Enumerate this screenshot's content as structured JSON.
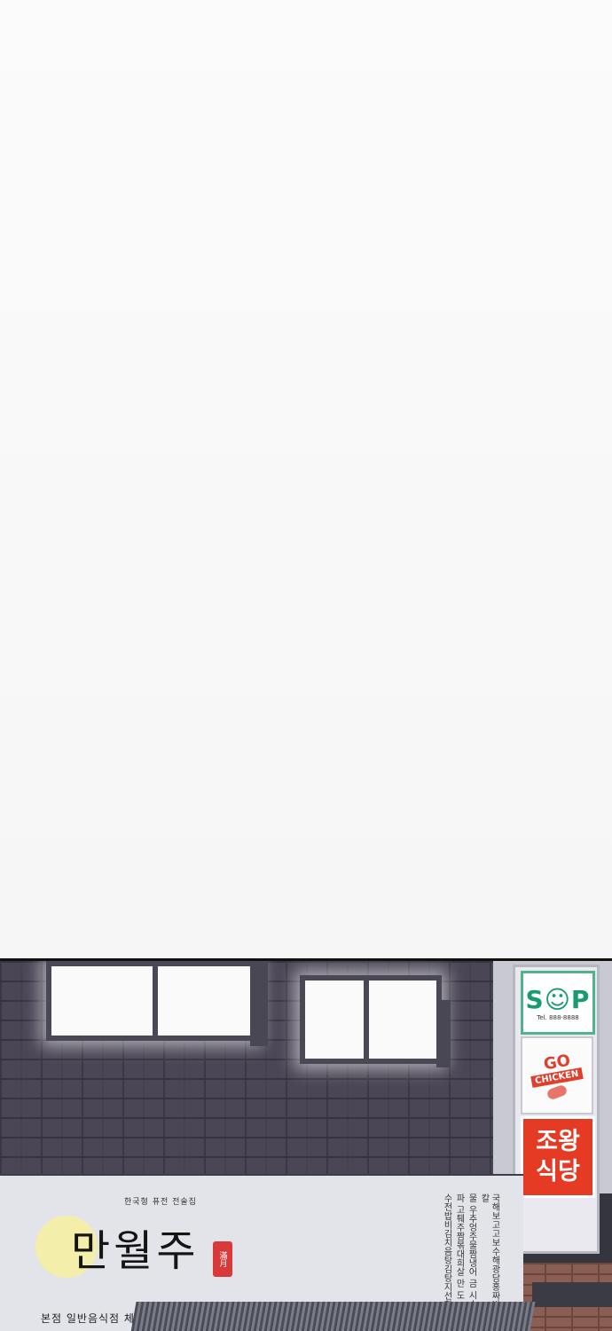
{
  "panel": {
    "storefront": {
      "subtitle": "한국형 퓨전 전술집",
      "title": "만월주",
      "seal_text": "滿月",
      "bottom_line": "본점 일반음식점 체인점문의",
      "menu_columns": [
        "국해보고고보수해광담홍짜반김칼",
        "물 우추엉주물짬냉어 금 시소",
        "파 고퉤주짬볶대희살 만 도",
        "수전밥비김치음탕김탕지선향우"
      ]
    },
    "signs": {
      "sop_logo": "S☺P",
      "sop_tel": "Tel. 888-8888",
      "chicken_logo": "GO",
      "chicken_label": "CHICKEN",
      "jowang_line1": "조왕",
      "jowang_line2": "식당"
    }
  },
  "colors": {
    "sky": "#f7f7f7",
    "brick": "#6c6878",
    "sign_red": "#e53a24",
    "sign_green": "#189c6d",
    "moon": "#f4f0a4"
  }
}
